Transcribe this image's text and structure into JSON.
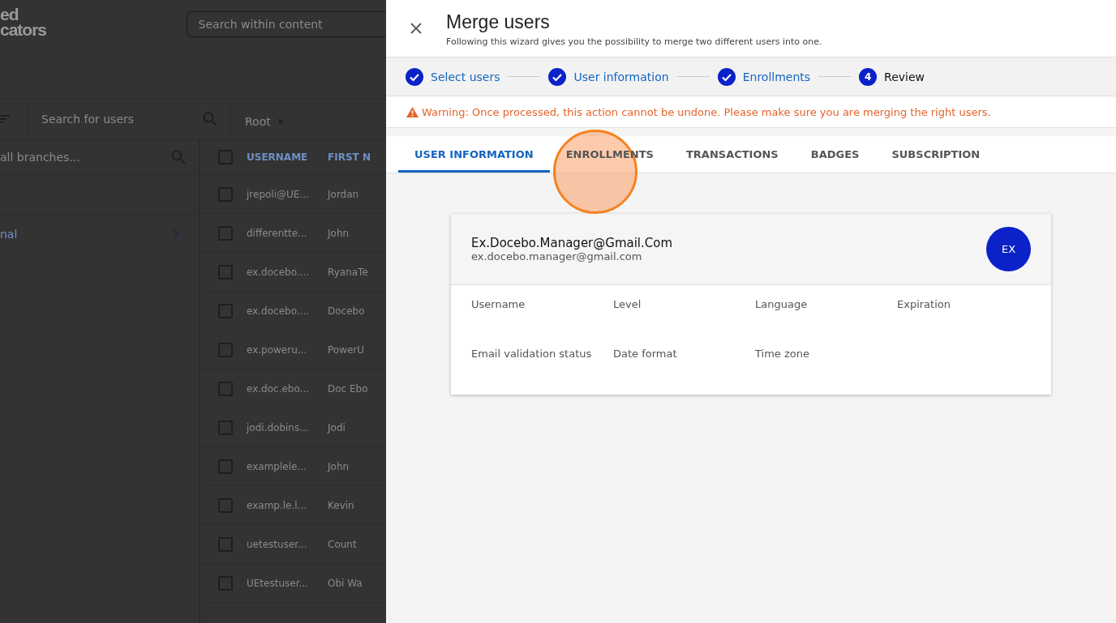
{
  "background_page": {
    "logo_lines": [
      "ed",
      "cators"
    ],
    "content_search": {
      "placeholder": "Search within content"
    },
    "user_search": {
      "placeholder": "Search for users"
    },
    "breadcrumb": "Root",
    "branch_search": {
      "placeholder": "all branches..."
    },
    "branches": [
      {
        "label": "nal"
      }
    ],
    "table": {
      "columns": [
        "USERNAME",
        "FIRST N"
      ],
      "rows": [
        {
          "checked": false,
          "username": "jrepoli@UE...",
          "first_name": "Jordan"
        },
        {
          "checked": false,
          "username": "differentte...",
          "first_name": "John"
        },
        {
          "checked": false,
          "username": "ex.docebo....",
          "first_name": "RyanaTe"
        },
        {
          "checked": false,
          "username": "ex.docebo....",
          "first_name": "Docebo"
        },
        {
          "checked": false,
          "username": "ex.poweru...",
          "first_name": "PowerU"
        },
        {
          "checked": false,
          "username": "ex.doc.ebo...",
          "first_name": "Doc Ebo"
        },
        {
          "checked": false,
          "username": "jodi.dobins...",
          "first_name": "Jodi"
        },
        {
          "checked": false,
          "username": "examplele...",
          "first_name": "John"
        },
        {
          "checked": false,
          "username": "examp.le.l...",
          "first_name": "Kevin"
        },
        {
          "checked": false,
          "username": "uetestuser...",
          "first_name": "Count"
        },
        {
          "checked": false,
          "username": "UEtestuser...",
          "first_name": "Obi Wa"
        }
      ],
      "header_checked": false
    }
  },
  "drawer": {
    "title": "Merge users",
    "subtitle": "Following this wizard gives you the possibility to merge two different users into one.",
    "steps": [
      {
        "kind": "done",
        "label": "Select users"
      },
      {
        "kind": "done",
        "label": "User information"
      },
      {
        "kind": "done",
        "label": "Enrollments"
      },
      {
        "kind": "current",
        "number": "4",
        "label": "Review"
      }
    ],
    "warning": "Warning: Once processed, this action cannot be undone. Please make sure you are merging the right users.",
    "tabs": [
      {
        "label": "USER INFORMATION",
        "selected": true
      },
      {
        "label": "ENROLLMENTS",
        "selected": false
      },
      {
        "label": "TRANSACTIONS",
        "selected": false
      },
      {
        "label": "BADGES",
        "selected": false
      },
      {
        "label": "SUBSCRIPTION",
        "selected": false
      }
    ],
    "user_card": {
      "name": "Ex.Docebo.Manager@Gmail.Com",
      "email": "ex.docebo.manager@gmail.com",
      "avatar": "EX",
      "fields": [
        "Username",
        "Level",
        "Language",
        "Expiration",
        "Email validation status",
        "Date format",
        "Time zone"
      ]
    }
  }
}
